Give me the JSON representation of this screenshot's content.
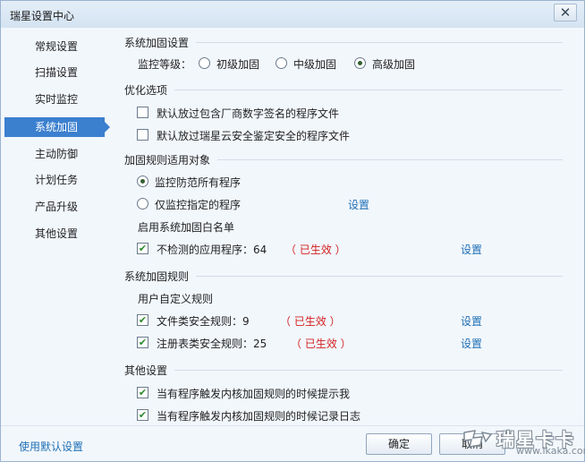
{
  "window": {
    "title": "瑞星设置中心",
    "close_glyph": "✕"
  },
  "sidebar": {
    "items": [
      {
        "label": "常规设置"
      },
      {
        "label": "扫描设置"
      },
      {
        "label": "实时监控"
      },
      {
        "label": "系统加固",
        "active": true
      },
      {
        "label": "主动防御"
      },
      {
        "label": "计划任务"
      },
      {
        "label": "产品升级"
      },
      {
        "label": "其他设置"
      }
    ]
  },
  "hardening_settings": {
    "title": "系统加固设置",
    "level_label": "监控等级：",
    "levels": [
      {
        "label": "初级加固",
        "checked": false
      },
      {
        "label": "中级加固",
        "checked": false
      },
      {
        "label": "高级加固",
        "checked": true
      }
    ]
  },
  "optimization": {
    "title": "优化选项",
    "options": [
      {
        "label": "默认放过包含厂商数字签名的程序文件",
        "checked": false
      },
      {
        "label": "默认放过瑞星云安全鉴定安全的程序文件",
        "checked": false
      }
    ]
  },
  "targets": {
    "title": "加固规则适用对象",
    "options": [
      {
        "label": "监控防范所有程序",
        "checked": true
      },
      {
        "label": "仅监控指定的程序",
        "checked": false
      }
    ],
    "specified_link": "设置",
    "whitelist_label": "启用系统加固白名单",
    "whitelist_item": {
      "label": "不检测的应用程序：64",
      "checked": true,
      "status": "（ 已生效 ）",
      "link": "设置"
    }
  },
  "rules": {
    "title": "系统加固规则",
    "custom_label": "用户自定义规则",
    "items": [
      {
        "label": "文件类安全规则：9",
        "checked": true,
        "status": "（ 已生效 ）",
        "link": "设置"
      },
      {
        "label": "注册表类安全规则：25",
        "checked": true,
        "status": "（ 已生效 ）",
        "link": "设置"
      }
    ]
  },
  "other": {
    "title": "其他设置",
    "options": [
      {
        "label": "当有程序触发内核加固规则的时候提示我",
        "checked": true
      },
      {
        "label": "当有程序触发内核加固规则的时候记录日志",
        "checked": true
      }
    ]
  },
  "footer": {
    "default_link": "使用默认设置",
    "ok_label": "确定",
    "cancel_label": "取消"
  },
  "watermark": {
    "brand": "瑞星卡卡",
    "url": "www.ikaka.com"
  },
  "check_glyph": "✔"
}
